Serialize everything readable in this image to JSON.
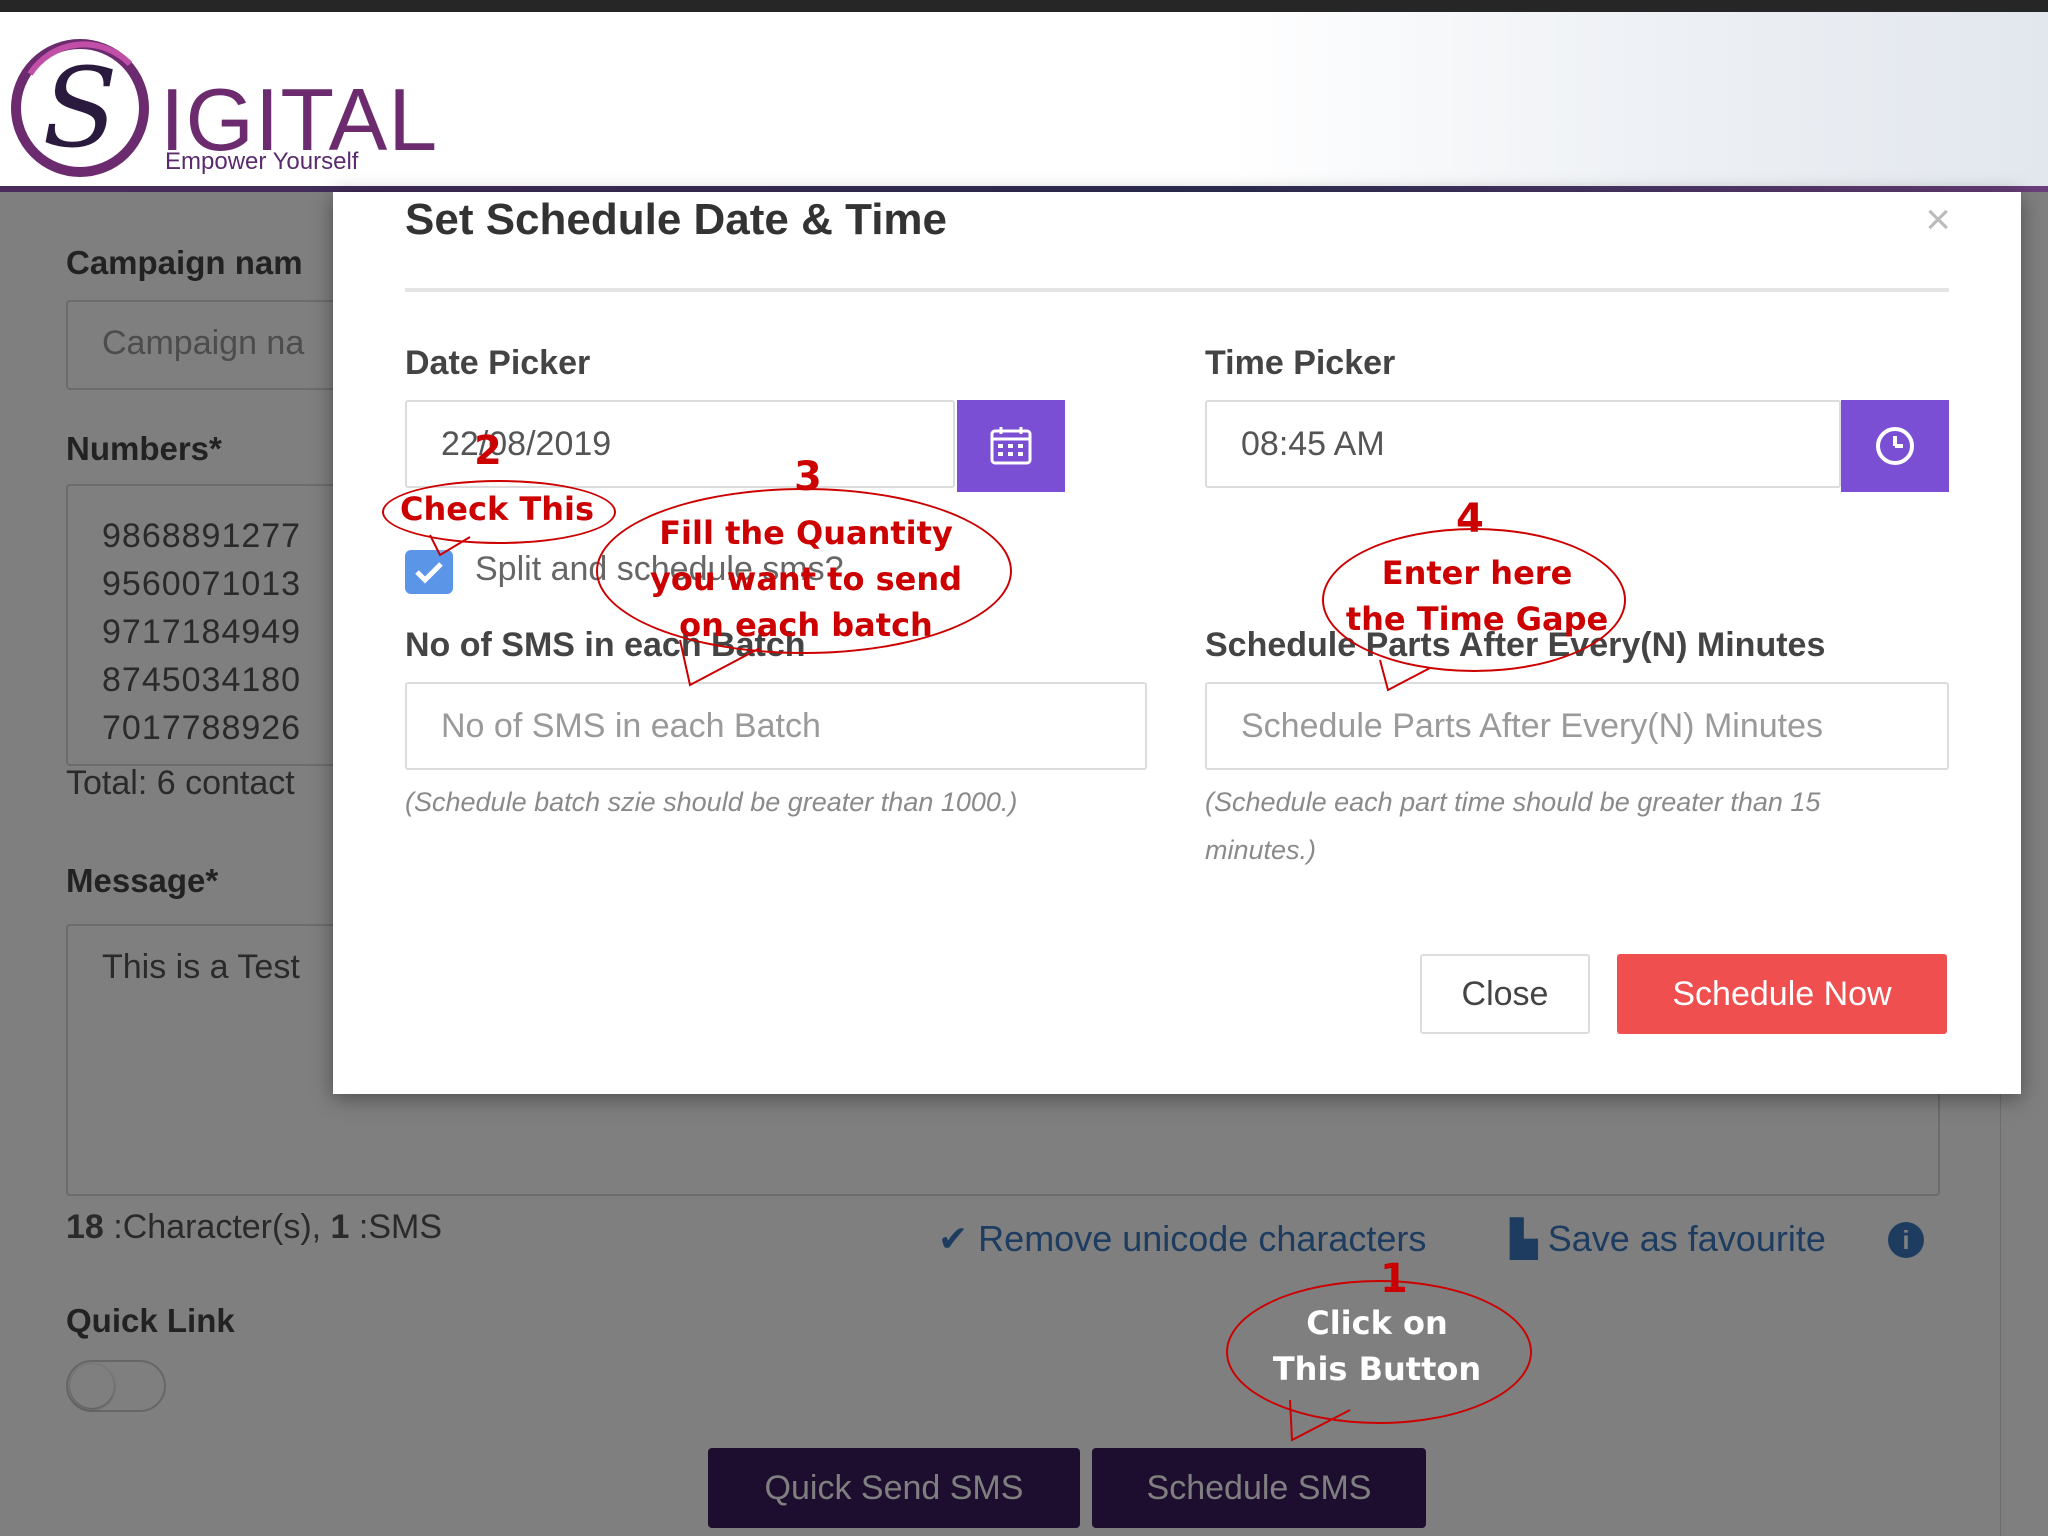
{
  "brand": {
    "logo_letter": "S",
    "name": "IGITAL",
    "tagline": "Empower Yourself"
  },
  "form": {
    "campaign_label": "Campaign nam",
    "campaign_placeholder": "Campaign na",
    "numbers_label": "Numbers*",
    "numbers": [
      "9868891277",
      "9560071013",
      "9717184949",
      "8745034180",
      "7017788926"
    ],
    "total": "Total: 6 contact",
    "message_label": "Message*",
    "message_text": "This is a Test",
    "char_count": "18",
    "char_label": " :Character(s), ",
    "sms_count": "1",
    "sms_label": " :SMS",
    "remove_unicode": "Remove unicode characters",
    "save_favourite": "Save as favourite",
    "quick_link_label": "Quick Link",
    "quick_send_button": "Quick Send SMS",
    "schedule_sms_button": "Schedule SMS"
  },
  "modal": {
    "title": "Set Schedule Date & Time",
    "close_x": "×",
    "date_label": "Date Picker",
    "date_value": "22/08/2019",
    "time_label": "Time Picker",
    "time_value": "08:45 AM",
    "split_label": "Split and schedule sms?",
    "batch_label": "No of SMS in each Batch",
    "batch_placeholder": "No of SMS in each Batch",
    "batch_hint": "(Schedule batch szie should be greater than 1000.)",
    "parts_label": "Schedule Parts After Every(N) Minutes",
    "parts_placeholder": "Schedule Parts After Every(N) Minutes",
    "parts_hint_line1": "(Schedule each part time should be greater than 15",
    "parts_hint_line2": "minutes.)",
    "close_button": "Close",
    "schedule_now_button": "Schedule Now"
  },
  "annotations": {
    "a1_num": "1",
    "a1_line1": "Click on",
    "a1_line2": "This Button",
    "a2_num": "2",
    "a2_text": "Check This",
    "a3_num": "3",
    "a3_line1": "Fill the Quantity",
    "a3_line2": "you want to send",
    "a3_line3": "on each batch",
    "a4_num": "4",
    "a4_line1": "Enter here",
    "a4_line2": "the Time Gape"
  },
  "colors": {
    "accent": "#7b4fd4",
    "danger": "#ef4f4f",
    "brand": "#6b2b6e",
    "annotation": "#cc0000"
  }
}
